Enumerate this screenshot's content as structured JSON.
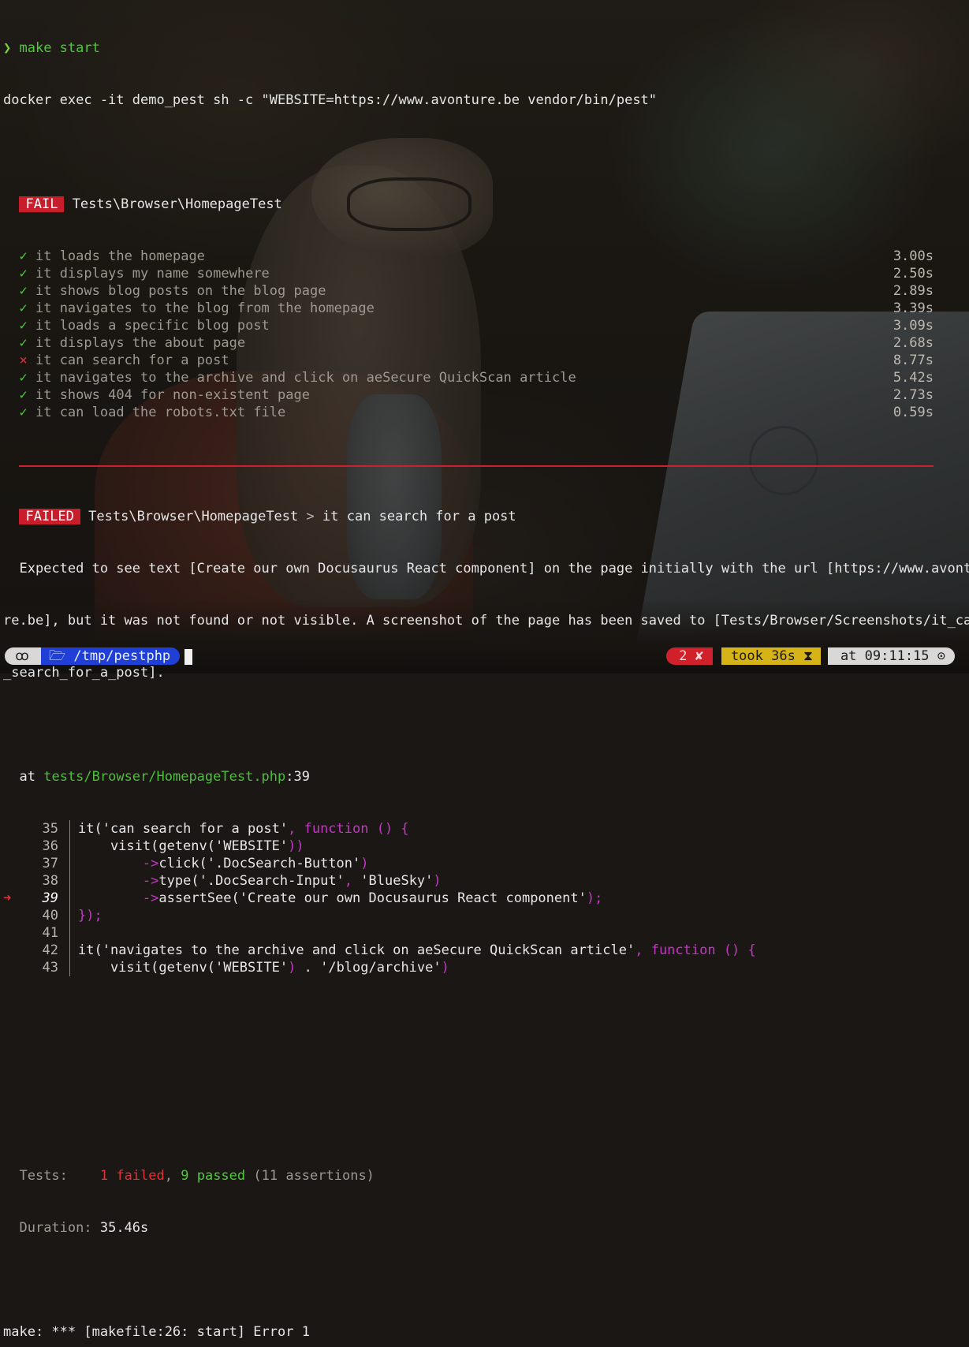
{
  "command": {
    "prompt_symbol": "❯",
    "input": "make start",
    "echo": "docker exec -it demo_pest sh -c \"WEBSITE=https://www.avonture.be vendor/bin/pest\""
  },
  "suite": {
    "status": "FAIL",
    "name": "Tests\\Browser\\HomepageTest",
    "tests": [
      {
        "mark": "✓",
        "passed": true,
        "label": "it loads the homepage",
        "time": "3.00s"
      },
      {
        "mark": "✓",
        "passed": true,
        "label": "it displays my name somewhere",
        "time": "2.50s"
      },
      {
        "mark": "✓",
        "passed": true,
        "label": "it shows blog posts on the blog page",
        "time": "2.89s"
      },
      {
        "mark": "✓",
        "passed": true,
        "label": "it navigates to the blog from the homepage",
        "time": "3.39s"
      },
      {
        "mark": "✓",
        "passed": true,
        "label": "it loads a specific blog post",
        "time": "3.09s"
      },
      {
        "mark": "✓",
        "passed": true,
        "label": "it displays the about page",
        "time": "2.68s"
      },
      {
        "mark": "×",
        "passed": false,
        "label": "it can search for a post",
        "time": "8.77s"
      },
      {
        "mark": "✓",
        "passed": true,
        "label": "it navigates to the archive and click on aeSecure QuickScan article",
        "time": "5.42s"
      },
      {
        "mark": "✓",
        "passed": true,
        "label": "it shows 404 for non-existent page",
        "time": "2.73s"
      },
      {
        "mark": "✓",
        "passed": true,
        "label": "it can load the robots.txt file",
        "time": "0.59s"
      }
    ]
  },
  "failure": {
    "badge": "FAILED",
    "suite": "Tests\\Browser\\HomepageTest",
    "arrow": ">",
    "test": "it can search for a post",
    "message_lines": [
      "  Expected to see text [Create our own Docusaurus React component] on the page initially with the url [https://www.avontu",
      "re.be], but it was not found or not visible. A screenshot of the page has been saved to [Tests/Browser/Screenshots/it_can",
      "_search_for_a_post]."
    ],
    "at_label": "at",
    "file": "tests/Browser/HomepageTest.php",
    "line": ":39"
  },
  "code": [
    {
      "num": "35",
      "current": false,
      "parts": [
        [
          "plain",
          "it("
        ],
        [
          "str",
          "'can search for a post'"
        ],
        [
          "kw",
          ", function () {"
        ]
      ]
    },
    {
      "num": "36",
      "current": false,
      "parts": [
        [
          "plain",
          "    visit(getenv("
        ],
        [
          "str",
          "'WEBSITE'"
        ],
        [
          "kw",
          "))"
        ]
      ]
    },
    {
      "num": "37",
      "current": false,
      "parts": [
        [
          "plain",
          "        "
        ],
        [
          "kw",
          "->"
        ],
        [
          "plain",
          "click("
        ],
        [
          "str",
          "'.DocSearch-Button'"
        ],
        [
          "kw",
          ")"
        ]
      ]
    },
    {
      "num": "38",
      "current": false,
      "parts": [
        [
          "plain",
          "        "
        ],
        [
          "kw",
          "->"
        ],
        [
          "plain",
          "type("
        ],
        [
          "str",
          "'.DocSearch-Input'"
        ],
        [
          "kw",
          ", "
        ],
        [
          "str",
          "'BlueSky'"
        ],
        [
          "kw",
          ")"
        ]
      ]
    },
    {
      "num": "39",
      "current": true,
      "parts": [
        [
          "plain",
          "        "
        ],
        [
          "kw",
          "->"
        ],
        [
          "plain",
          "assertSee("
        ],
        [
          "str",
          "'Create our own Docusaurus React component'"
        ],
        [
          "kw",
          ");"
        ]
      ]
    },
    {
      "num": "40",
      "current": false,
      "parts": [
        [
          "kw",
          "});"
        ]
      ]
    },
    {
      "num": "41",
      "current": false,
      "parts": []
    },
    {
      "num": "42",
      "current": false,
      "parts": [
        [
          "plain",
          "it("
        ],
        [
          "str",
          "'navigates to the archive and click on aeSecure QuickScan article'"
        ],
        [
          "kw",
          ", function () {"
        ]
      ]
    },
    {
      "num": "43",
      "current": false,
      "parts": [
        [
          "plain",
          "    visit(getenv("
        ],
        [
          "str",
          "'WEBSITE'"
        ],
        [
          "kw",
          ")"
        ],
        [
          "plain",
          " . "
        ],
        [
          "str",
          "'/blog/archive'"
        ],
        [
          "kw",
          ")"
        ]
      ]
    }
  ],
  "current_marker": "➜",
  "summary": {
    "tests_label": "Tests:",
    "failed": "1 failed",
    "comma": ",",
    "passed": "9 passed",
    "assertions": "(11 assertions)",
    "duration_label": "Duration:",
    "duration": "35.46s"
  },
  "make_error": "make: *** [makefile:26: start] Error 1",
  "statusbar": {
    "os_icon": "ꝏ",
    "dir_icon": "🗁",
    "dir": "/tmp/pestphp",
    "errors": "2 ✘",
    "took": "took 36s ⧗",
    "at": "at 09:11:15 ⊙"
  },
  "colors": {
    "pass": "#4fc93a",
    "fail": "#e0323a",
    "badge": "#c81d2a",
    "keyword": "#c536c5",
    "path": "#4cbf3a",
    "status_dir": "#1f3fd6",
    "status_err": "#d0202a",
    "status_took": "#d6b417"
  }
}
